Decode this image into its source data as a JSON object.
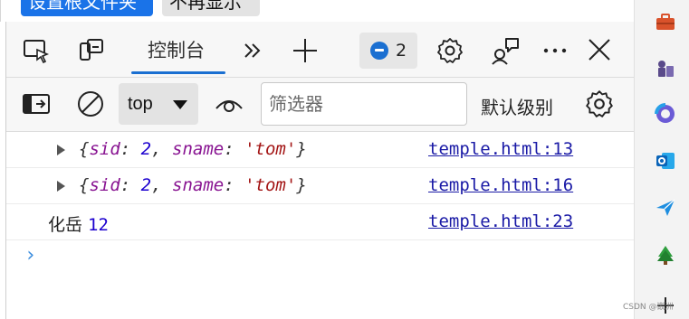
{
  "page_buttons": {
    "set_root_node": "设置根文件夹",
    "hide": "不再显示"
  },
  "tabbar": {
    "active_tab": "控制台",
    "message_count": "2"
  },
  "toolbar": {
    "context_selector": "top",
    "filter_placeholder": "筛选器",
    "filter_value": "",
    "log_level": "默认级别"
  },
  "console": {
    "rows": [
      {
        "text_parts": [
          "{",
          "sid",
          ": ",
          "2",
          ", ",
          "sname",
          ": ",
          "'tom'",
          "}"
        ],
        "source": "temple.html:13"
      },
      {
        "text_parts": [
          "{",
          "sid",
          ": ",
          "2",
          ", ",
          "sname",
          ": ",
          "'tom'",
          "}"
        ],
        "source": "temple.html:16"
      },
      {
        "label": "化岳",
        "number": "12",
        "source": "temple.html:23"
      }
    ],
    "prompt": "›"
  },
  "sidebar": {
    "icons": [
      "toolbox-icon",
      "chess-icon",
      "copilot-icon",
      "outlook-icon",
      "send-icon",
      "tree-icon",
      "plus-icon"
    ]
  },
  "watermark": "CSDN @嵌洲"
}
